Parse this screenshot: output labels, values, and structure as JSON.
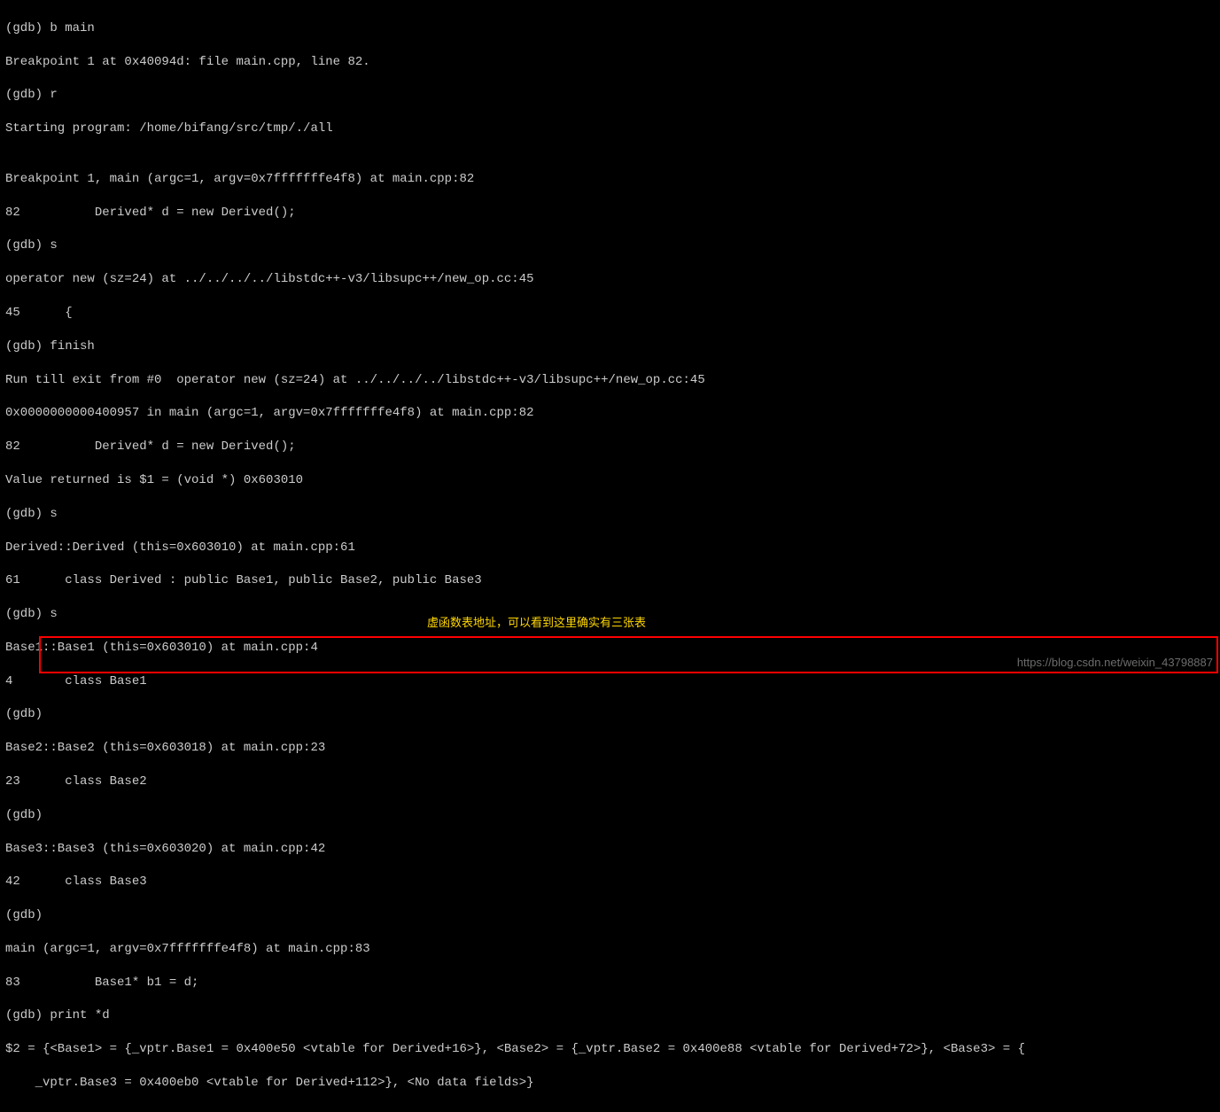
{
  "lines": [
    "(gdb) b main",
    "Breakpoint 1 at 0x40094d: file main.cpp, line 82.",
    "(gdb) r",
    "Starting program: /home/bifang/src/tmp/./all",
    "",
    "Breakpoint 1, main (argc=1, argv=0x7fffffffe4f8) at main.cpp:82",
    "82          Derived* d = new Derived();",
    "(gdb) s",
    "operator new (sz=24) at ../../../../libstdc++-v3/libsupc++/new_op.cc:45",
    "45      {",
    "(gdb) finish",
    "Run till exit from #0  operator new (sz=24) at ../../../../libstdc++-v3/libsupc++/new_op.cc:45",
    "0x0000000000400957 in main (argc=1, argv=0x7fffffffe4f8) at main.cpp:82",
    "82          Derived* d = new Derived();",
    "Value returned is $1 = (void *) 0x603010",
    "(gdb) s",
    "Derived::Derived (this=0x603010) at main.cpp:61",
    "61      class Derived : public Base1, public Base2, public Base3",
    "(gdb) s",
    "Base1::Base1 (this=0x603010) at main.cpp:4",
    "4       class Base1",
    "(gdb)",
    "Base2::Base2 (this=0x603018) at main.cpp:23",
    "23      class Base2",
    "(gdb)",
    "Base3::Base3 (this=0x603020) at main.cpp:42",
    "42      class Base3",
    "(gdb)",
    "main (argc=1, argv=0x7fffffffe4f8) at main.cpp:83",
    "83          Base1* b1 = d;",
    "(gdb) print *d",
    "$2 = {<Base1> = {_vptr.Base1 = 0x400e50 <vtable for Derived+16>}, <Base2> = {_vptr.Base2 = 0x400e88 <vtable for Derived+72>}, <Base3> = {",
    "    _vptr.Base3 = 0x400eb0 <vtable for Derived+112>}, <No data fields>}"
  ],
  "annotation": "虚函数表地址，可以看到这里确实有三张表",
  "watermark": "https://blog.csdn.net/weixin_43798887"
}
